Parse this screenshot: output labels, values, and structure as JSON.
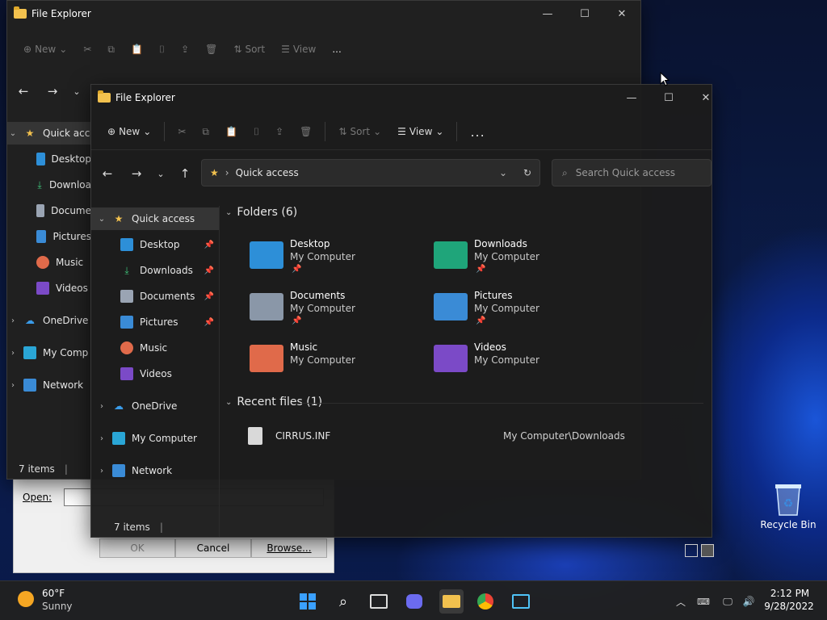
{
  "window_title": "File Explorer",
  "toolbar": {
    "new": "New",
    "sort": "Sort",
    "view": "View",
    "more": "..."
  },
  "address": {
    "path": "Quick access",
    "search_placeholder": "Search Quick access"
  },
  "nav": {
    "quick_access": "Quick access",
    "pinned": [
      {
        "label": "Desktop",
        "icon": "desktop-icon"
      },
      {
        "label": "Downloads",
        "icon": "download-icon"
      },
      {
        "label": "Documents",
        "icon": "document-icon"
      },
      {
        "label": "Pictures",
        "icon": "pictures-icon"
      },
      {
        "label": "Music",
        "icon": "music-icon"
      },
      {
        "label": "Videos",
        "icon": "videos-icon"
      }
    ],
    "onedrive": "OneDrive",
    "my_computer": "My Computer",
    "network": "Network"
  },
  "back_nav": {
    "quick_access": "Quick acc",
    "items": [
      "Desktop",
      "Downloa",
      "Docume",
      "Pictures",
      "Music",
      "Videos"
    ],
    "onedrive": "OneDrive",
    "my_computer": "My Comp",
    "network": "Network",
    "status": "7 items"
  },
  "folders": {
    "header": "Folders (6)",
    "items": [
      {
        "name": "Desktop",
        "location": "My Computer",
        "color": "#2d8fd8"
      },
      {
        "name": "Downloads",
        "location": "My Computer",
        "color": "#1fa57a"
      },
      {
        "name": "Documents",
        "location": "My Computer",
        "color": "#8a97a8"
      },
      {
        "name": "Pictures",
        "location": "My Computer",
        "color": "#3a8bd6"
      },
      {
        "name": "Music",
        "location": "My Computer",
        "color": "#e06a4a"
      },
      {
        "name": "Videos",
        "location": "My Computer",
        "color": "#7b4ac7"
      }
    ]
  },
  "recent": {
    "header": "Recent files (1)",
    "files": [
      {
        "name": "CIRRUS.INF",
        "path": "My Computer\\Downloads"
      }
    ]
  },
  "status": {
    "items": "7 items"
  },
  "dialog": {
    "open_label": "Open:",
    "ok": "OK",
    "cancel": "Cancel",
    "browse": "Browse..."
  },
  "desktop": {
    "recycle_bin": "Recycle Bin"
  },
  "taskbar": {
    "temp": "60°F",
    "weather": "Sunny",
    "time": "2:12 PM",
    "date": "9/28/2022"
  },
  "colors": {
    "accent": "#f2c14e",
    "dark_bg": "#1c1c1c",
    "taskbar": "#202020"
  }
}
